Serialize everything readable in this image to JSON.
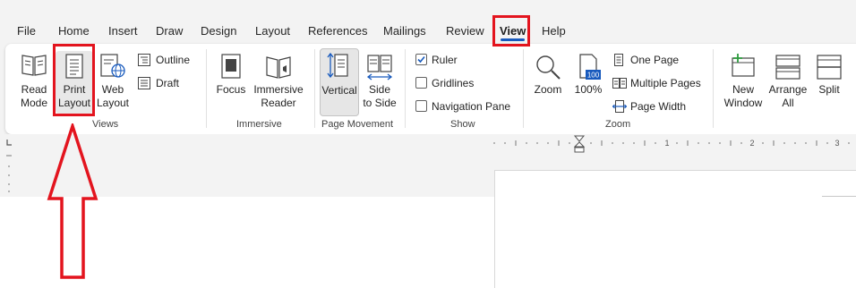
{
  "menu": {
    "tabs": [
      {
        "label": "File"
      },
      {
        "label": "Home"
      },
      {
        "label": "Insert"
      },
      {
        "label": "Draw"
      },
      {
        "label": "Design"
      },
      {
        "label": "Layout"
      },
      {
        "label": "References"
      },
      {
        "label": "Mailings"
      },
      {
        "label": "Review"
      },
      {
        "label": "View",
        "active": true
      },
      {
        "label": "Help"
      }
    ]
  },
  "ribbon": {
    "views": {
      "group_label": "Views",
      "read_mode": "Read Mode",
      "print_layout": "Print Layout",
      "web_layout": "Web Layout",
      "outline": "Outline",
      "draft": "Draft"
    },
    "immersive": {
      "group_label": "Immersive",
      "focus": "Focus",
      "immersive_reader": "Immersive Reader"
    },
    "page_movement": {
      "group_label": "Page Movement",
      "vertical": "Vertical",
      "side_to_side": "Side to Side"
    },
    "show": {
      "group_label": "Show",
      "ruler": "Ruler",
      "ruler_checked": true,
      "gridlines": "Gridlines",
      "gridlines_checked": false,
      "navigation_pane": "Navigation Pane",
      "navigation_pane_checked": false
    },
    "zoom": {
      "group_label": "Zoom",
      "zoom": "Zoom",
      "percent": "100%",
      "one_page": "One Page",
      "multiple_pages": "Multiple Pages",
      "page_width": "Page Width"
    },
    "window": {
      "new_window": "New Window",
      "arrange_all": "Arrange All",
      "split": "Split"
    }
  },
  "ruler": {
    "numbers": [
      "1",
      "2",
      "3"
    ]
  },
  "colors": {
    "accent": "#185abd",
    "annotation": "#e3141e",
    "ribbon_bg": "#ffffff",
    "chrome_bg": "#f3f3f3"
  }
}
